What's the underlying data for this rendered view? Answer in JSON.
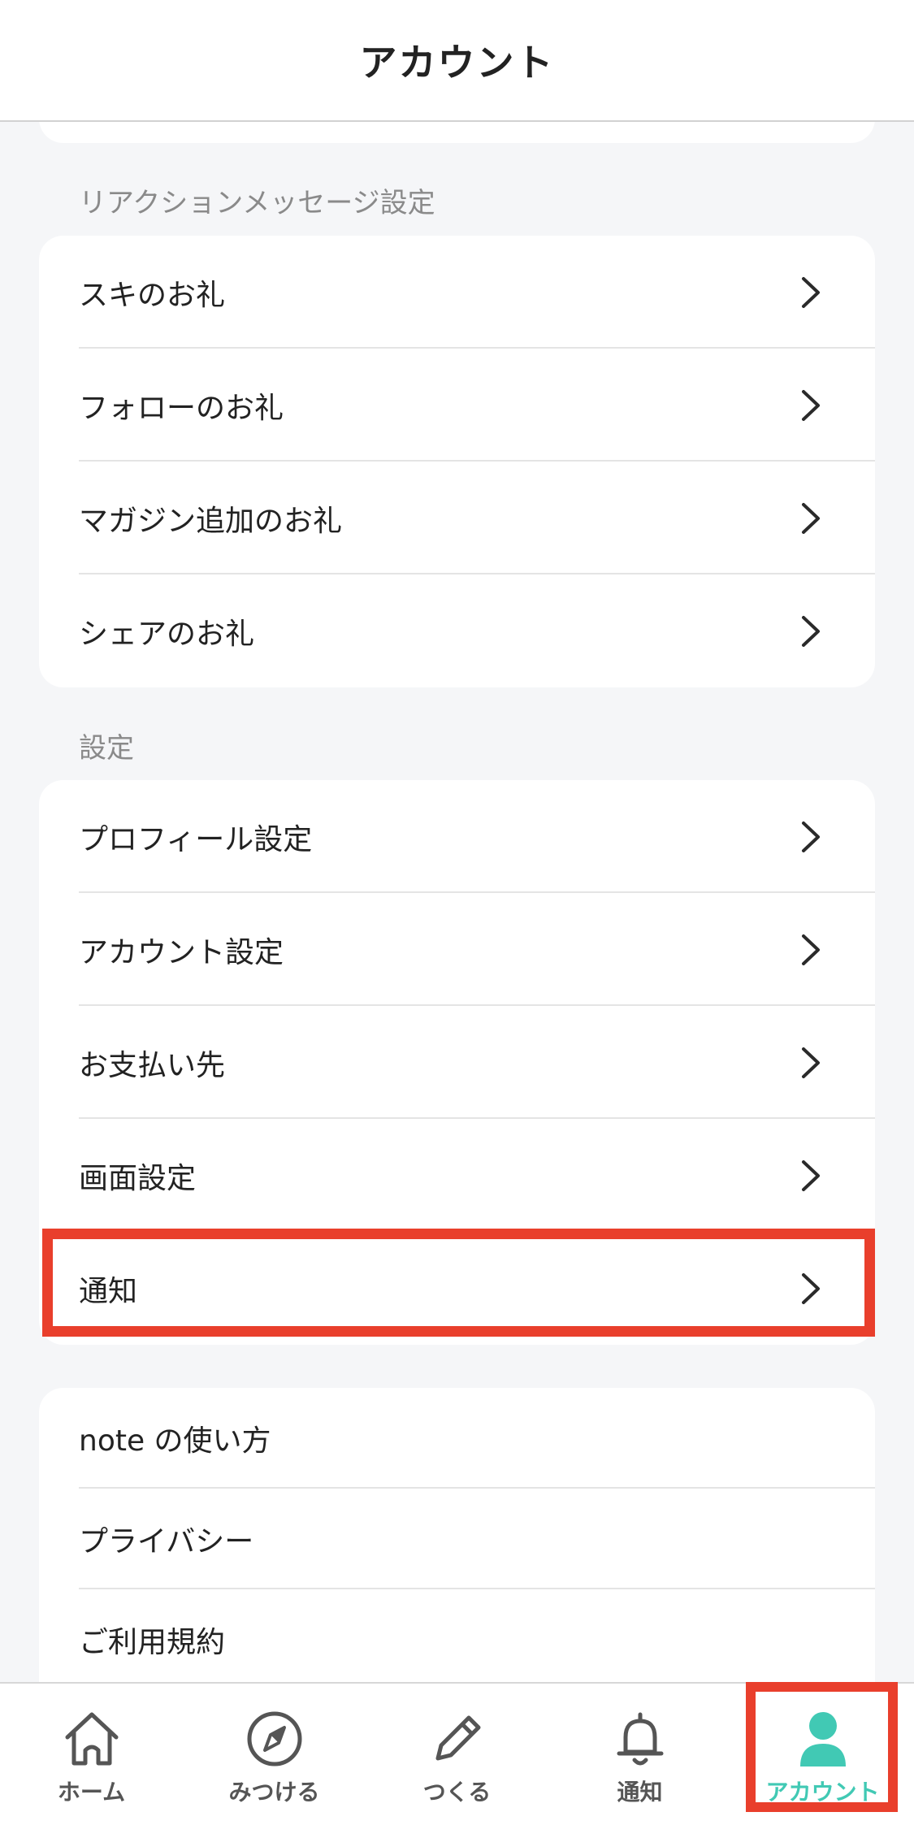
{
  "header": {
    "title": "アカウント"
  },
  "sections": {
    "reaction": {
      "label": "リアクションメッセージ設定",
      "items": [
        {
          "label": "スキのお礼"
        },
        {
          "label": "フォローのお礼"
        },
        {
          "label": "マガジン追加のお礼"
        },
        {
          "label": "シェアのお礼"
        }
      ]
    },
    "settings": {
      "label": "設定",
      "items": [
        {
          "label": "プロフィール設定"
        },
        {
          "label": "アカウント設定"
        },
        {
          "label": "お支払い先"
        },
        {
          "label": "画面設定"
        },
        {
          "label": "通知"
        }
      ]
    },
    "info": {
      "items": [
        {
          "label": "note の使い方"
        },
        {
          "label": "プライバシー"
        },
        {
          "label": "ご利用規約"
        }
      ]
    }
  },
  "tabbar": {
    "tabs": [
      {
        "label": "ホーム",
        "icon": "home-icon"
      },
      {
        "label": "みつける",
        "icon": "compass-icon"
      },
      {
        "label": "つくる",
        "icon": "pencil-icon"
      },
      {
        "label": "通知",
        "icon": "bell-icon"
      },
      {
        "label": "アカウント",
        "icon": "person-icon",
        "active": true
      }
    ]
  },
  "colors": {
    "accent": "#41c9b4",
    "highlight": "#e93f2c"
  }
}
